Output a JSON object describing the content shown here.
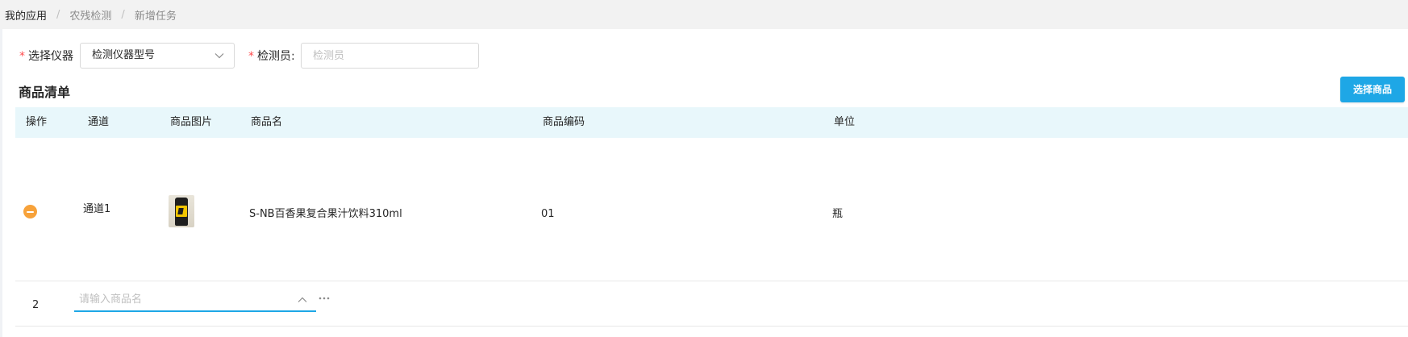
{
  "breadcrumb": {
    "items": [
      "我的应用",
      "农残检测",
      "新增任务"
    ],
    "separator": "/"
  },
  "form": {
    "instrument": {
      "required_mark": "*",
      "label": "选择仪器",
      "selected_value": "检测仪器型号",
      "icon": "chevron-down-icon"
    },
    "inspector": {
      "required_mark": "*",
      "label": "检测员:",
      "placeholder": "检测员"
    }
  },
  "product_list": {
    "title": "商品清单",
    "select_button_label": "选择商品",
    "columns": [
      "操作",
      "通道",
      "商品图片",
      "商品名",
      "商品编码",
      "单位"
    ],
    "rows": [
      {
        "action_icon": "remove-circle-icon",
        "channel": "通道1",
        "image": "beverage-can-thumbnail",
        "name": "S-NB百香果复合果汁饮料310ml",
        "code": "01",
        "unit": "瓶"
      }
    ],
    "new_row": {
      "index": "2",
      "name_placeholder": "请输入商品名",
      "icons": [
        "chevron-up-icon",
        "more-icon"
      ]
    }
  },
  "colors": {
    "accent": "#1ea7e6",
    "table_header_bg": "#e8f7fb",
    "required": "#ff4d4f",
    "remove_button": "#f7a23a"
  }
}
